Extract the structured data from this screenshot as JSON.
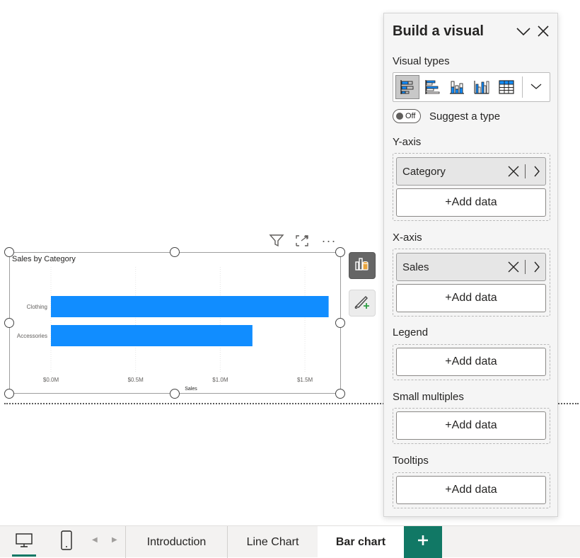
{
  "colors": {
    "accent": "#117865",
    "bar": "#118DFF",
    "pane_bg": "#f5f5f5"
  },
  "visual_header": {
    "icons": [
      "filter-icon",
      "focus-mode-icon",
      "more-options-icon"
    ],
    "more_label": "···"
  },
  "chart_data": {
    "type": "bar",
    "orientation": "horizontal",
    "title": "Sales by Category",
    "categories": [
      "Clothing",
      "Accessories"
    ],
    "values": [
      1.64,
      1.19
    ],
    "xlabel": "Sales",
    "ylabel": "",
    "xlim": [
      0,
      1.65
    ],
    "xticks": [
      0,
      0.5,
      1.0,
      1.5
    ],
    "xtick_labels": [
      "$0.0M",
      "$0.5M",
      "$1.0M",
      "$1.5M"
    ],
    "grid": true,
    "unit": "$M"
  },
  "side_buttons": {
    "build": "build-visual-icon",
    "format": "format-visual-icon"
  },
  "pane": {
    "title": "Build a visual",
    "visual_types_label": "Visual types",
    "visual_types": [
      {
        "name": "stacked-bar-chart-icon",
        "selected": true
      },
      {
        "name": "clustered-bar-chart-icon",
        "selected": false
      },
      {
        "name": "stacked-column-chart-icon",
        "selected": false
      },
      {
        "name": "clustered-column-chart-icon",
        "selected": false
      },
      {
        "name": "table-icon",
        "selected": false
      }
    ],
    "toggle_text": "Off",
    "suggest_label": "Suggest a type",
    "yaxis": {
      "label": "Y-axis",
      "field": "Category",
      "add": "+Add data"
    },
    "xaxis": {
      "label": "X-axis",
      "field": "Sales",
      "add": "+Add data"
    },
    "legend": {
      "label": "Legend",
      "add": "+Add data"
    },
    "small_multiples": {
      "label": "Small multiples",
      "add": "+Add data"
    },
    "tooltips": {
      "label": "Tooltips",
      "add": "+Add data"
    }
  },
  "tabbar": {
    "tabs": [
      {
        "label": "Introduction",
        "active": false
      },
      {
        "label": "Line Chart",
        "active": false
      },
      {
        "label": "Bar chart",
        "active": true
      }
    ],
    "add_label": "+"
  }
}
